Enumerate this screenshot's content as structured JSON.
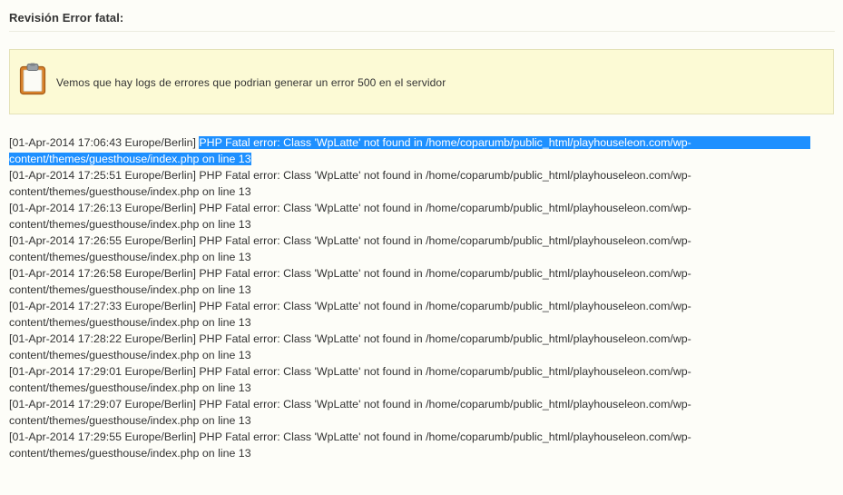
{
  "section": {
    "title": "Revisión Error fatal:"
  },
  "notice": {
    "icon": "clipboard-icon",
    "text": "Vemos que hay logs de errores que podrian generar un error 500 en el servidor",
    "colors": {
      "background": "#fcfad5",
      "border": "#e4e2b8"
    }
  },
  "log": {
    "selection_color": "#1e90ff",
    "entries": [
      {
        "timestamp": "[01-Apr-2014 17:06:43 Europe/Berlin] ",
        "message_line1": "PHP Fatal error: Class 'WpLatte' not found in /home/coparumb/public_html/playhouseleon.com/wp-",
        "message_line2": "content/themes/guesthouse/index.php on line 13"
      },
      {
        "timestamp": "[01-Apr-2014 17:25:51 Europe/Berlin] ",
        "message_line1": "PHP Fatal error: Class 'WpLatte' not found in /home/coparumb/public_html/playhouseleon.com/wp-",
        "message_line2": "content/themes/guesthouse/index.php on line 13"
      },
      {
        "timestamp": "[01-Apr-2014 17:26:13 Europe/Berlin] ",
        "message_line1": "PHP Fatal error: Class 'WpLatte' not found in /home/coparumb/public_html/playhouseleon.com/wp-",
        "message_line2": "content/themes/guesthouse/index.php on line 13"
      },
      {
        "timestamp": "[01-Apr-2014 17:26:55 Europe/Berlin] ",
        "message_line1": "PHP Fatal error: Class 'WpLatte' not found in /home/coparumb/public_html/playhouseleon.com/wp-",
        "message_line2": "content/themes/guesthouse/index.php on line 13"
      },
      {
        "timestamp": "[01-Apr-2014 17:26:58 Europe/Berlin] ",
        "message_line1": "PHP Fatal error: Class 'WpLatte' not found in /home/coparumb/public_html/playhouseleon.com/wp-",
        "message_line2": "content/themes/guesthouse/index.php on line 13"
      },
      {
        "timestamp": "[01-Apr-2014 17:27:33 Europe/Berlin] ",
        "message_line1": "PHP Fatal error: Class 'WpLatte' not found in /home/coparumb/public_html/playhouseleon.com/wp-",
        "message_line2": "content/themes/guesthouse/index.php on line 13"
      },
      {
        "timestamp": "[01-Apr-2014 17:28:22 Europe/Berlin] ",
        "message_line1": "PHP Fatal error: Class 'WpLatte' not found in /home/coparumb/public_html/playhouseleon.com/wp-",
        "message_line2": "content/themes/guesthouse/index.php on line 13"
      },
      {
        "timestamp": "[01-Apr-2014 17:29:01 Europe/Berlin] ",
        "message_line1": "PHP Fatal error: Class 'WpLatte' not found in /home/coparumb/public_html/playhouseleon.com/wp-",
        "message_line2": "content/themes/guesthouse/index.php on line 13"
      },
      {
        "timestamp": "[01-Apr-2014 17:29:07 Europe/Berlin] ",
        "message_line1": "PHP Fatal error: Class 'WpLatte' not found in /home/coparumb/public_html/playhouseleon.com/wp-",
        "message_line2": "content/themes/guesthouse/index.php on line 13"
      },
      {
        "timestamp": "[01-Apr-2014 17:29:55 Europe/Berlin] ",
        "message_line1": "PHP Fatal error: Class 'WpLatte' not found in /home/coparumb/public_html/playhouseleon.com/wp-",
        "message_line2": "content/themes/guesthouse/index.php on line 13"
      }
    ]
  }
}
